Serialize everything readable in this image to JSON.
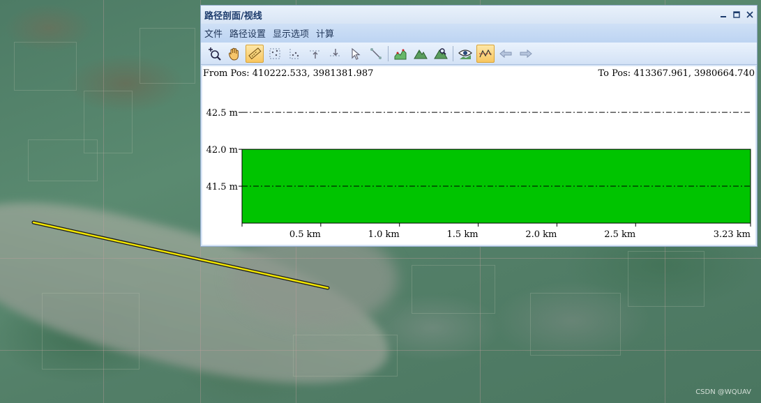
{
  "window": {
    "title": "路径剖面/视线",
    "controls": {
      "minimize": "_",
      "maximize": "□",
      "close": "✕"
    }
  },
  "menu": [
    "文件",
    "路径设置",
    "显示选项",
    "计算"
  ],
  "toolbar": {
    "tools": [
      {
        "icon": "zoom-in-icon",
        "active": false
      },
      {
        "icon": "pan-hand-icon",
        "active": false
      },
      {
        "icon": "ruler-icon",
        "active": true
      },
      {
        "icon": "select-points-icon",
        "active": false
      },
      {
        "icon": "point-cloud-icon",
        "active": false
      },
      {
        "icon": "vertical-align-top-icon",
        "active": false
      },
      {
        "icon": "vertical-align-bottom-icon",
        "active": false
      },
      {
        "icon": "pointer-icon",
        "active": false
      },
      {
        "icon": "line-tool-icon",
        "active": false
      },
      {
        "icon": "separator",
        "active": false
      },
      {
        "icon": "terrain-profile-icon",
        "active": false
      },
      {
        "icon": "mountain-icon",
        "active": false
      },
      {
        "icon": "mountain-edit-icon",
        "active": false
      },
      {
        "icon": "separator",
        "active": false
      },
      {
        "icon": "line-of-sight-eye-icon",
        "active": false
      },
      {
        "icon": "profile-line-icon",
        "active": true
      },
      {
        "icon": "arrow-left-icon",
        "active": false
      },
      {
        "icon": "arrow-right-icon",
        "active": false
      }
    ]
  },
  "chart_data": {
    "type": "area",
    "from_label": "From Pos: 410222.533, 3981381.987",
    "to_label": "To Pos: 413367.961, 3980664.740",
    "x_unit": "km",
    "y_unit": "m",
    "x_range": [
      0,
      3.23
    ],
    "y_range": [
      41.0,
      42.7
    ],
    "x_ticks": [
      {
        "value": 0.5,
        "label": "0.5 km"
      },
      {
        "value": 1.0,
        "label": "1.0 km"
      },
      {
        "value": 1.5,
        "label": "1.5 km"
      },
      {
        "value": 2.0,
        "label": "2.0 km"
      },
      {
        "value": 2.5,
        "label": "2.5 km"
      },
      {
        "value": 3.23,
        "label": "3.23 km"
      }
    ],
    "y_ticks": [
      {
        "value": 42.5,
        "label": "42.5 m",
        "line": "dashdot"
      },
      {
        "value": 42.0,
        "label": "42.0 m",
        "line": "none"
      },
      {
        "value": 41.5,
        "label": "41.5 m",
        "line": "dashdot"
      }
    ],
    "series": [
      {
        "x": [
          0,
          3.23
        ],
        "y": [
          42.0,
          42.0
        ],
        "color": "#00c400"
      }
    ]
  },
  "map": {
    "watermark": "CSDN @WQUAV",
    "path_color": "#f2e600"
  }
}
